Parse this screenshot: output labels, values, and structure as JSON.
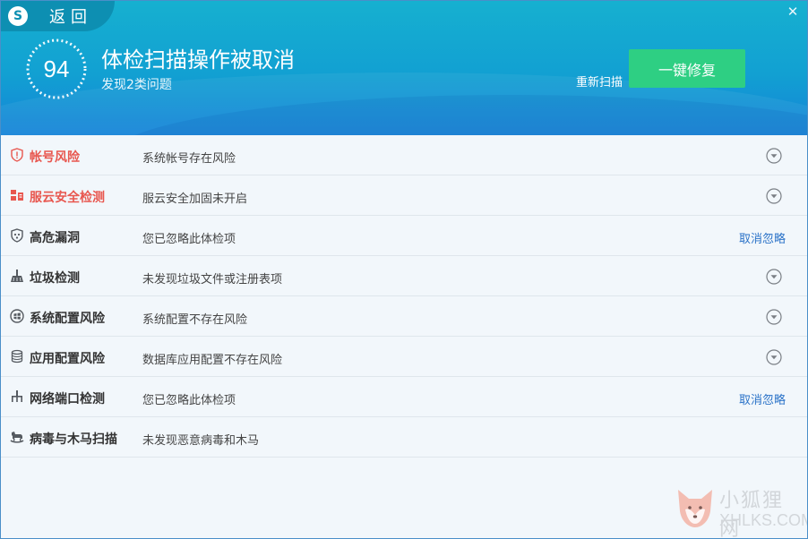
{
  "header": {
    "back_label": "返回",
    "logo_letter": "S",
    "score": "94",
    "title": "体检扫描操作被取消",
    "subtitle": "发现2类问题",
    "rescan_label": "重新扫描",
    "fix_label": "一键修复",
    "close_glyph": "✕"
  },
  "colors": {
    "header_top": "#16b0d0",
    "header_bottom": "#1583d8",
    "fix_button": "#2ecf83",
    "risk_text": "#e8574f",
    "link": "#2b73c8"
  },
  "rows": [
    {
      "icon": "shield-alert-icon",
      "name": "帐号风险",
      "desc": "系统帐号存在风险",
      "action": "expand",
      "risk": true
    },
    {
      "icon": "cloud-security-icon",
      "name": "服云安全检测",
      "desc": "服云安全加固未开启",
      "action": "expand",
      "risk": true
    },
    {
      "icon": "vulnerability-icon",
      "name": "高危漏洞",
      "desc": "您已忽略此体检项",
      "action": "cancel",
      "action_label": "取消忽略"
    },
    {
      "icon": "broom-icon",
      "name": "垃圾检测",
      "desc": "未发现垃圾文件或注册表项",
      "action": "expand"
    },
    {
      "icon": "windows-icon",
      "name": "系统配置风险",
      "desc": "系统配置不存在风险",
      "action": "expand"
    },
    {
      "icon": "database-icon",
      "name": "应用配置风险",
      "desc": "数据库应用配置不存在风险",
      "action": "expand"
    },
    {
      "icon": "network-port-icon",
      "name": "网络端口检测",
      "desc": "您已忽略此体检项",
      "action": "cancel",
      "action_label": "取消忽略"
    },
    {
      "icon": "trojan-horse-icon",
      "name": "病毒与木马扫描",
      "desc": "未发现恶意病毒和木马",
      "action": "none"
    }
  ],
  "watermark": {
    "name": "小狐狸网",
    "domain": "XHLKS.COM"
  }
}
